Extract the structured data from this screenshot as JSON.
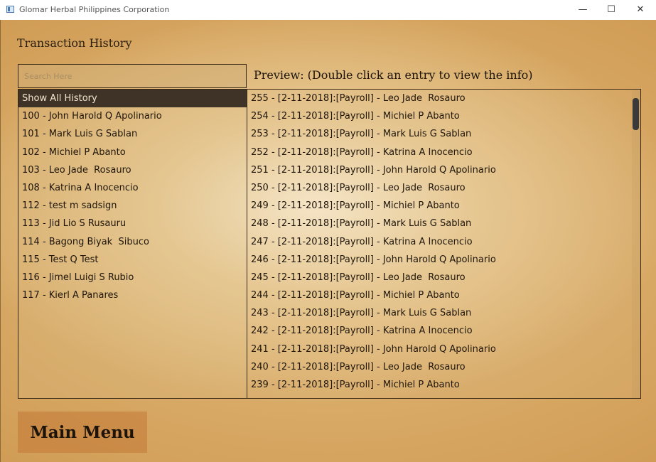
{
  "window": {
    "title": "Glomar Herbal Philippines Corporation",
    "minimize_glyph": "—",
    "maximize_glyph": "☐",
    "close_glyph": "✕"
  },
  "page": {
    "heading": "Transaction History",
    "preview_label": "Preview: (Double click an entry to view the info)",
    "main_menu_label": "Main Menu"
  },
  "search": {
    "placeholder": "Search Here",
    "value": ""
  },
  "employees": [
    "Show All History",
    "100 - John Harold Q Apolinario",
    "101 - Mark Luis G Sablan",
    "102 - Michiel P Abanto",
    "103 - Leo Jade  Rosauro",
    "108 - Katrina A Inocencio",
    "112 - test m sadsign",
    "113 - Jid Lio S Rusauru",
    "114 - Bagong Biyak  Sibuco",
    "115 - Test Q Test",
    "116 - Jimel Luigi S Rubio",
    "117 - Kierl A Panares"
  ],
  "selected_employee_index": 0,
  "transactions": [
    "255 - [2-11-2018]:[Payroll] - Leo Jade  Rosauro",
    "254 - [2-11-2018]:[Payroll] - Michiel P Abanto",
    "253 - [2-11-2018]:[Payroll] - Mark Luis G Sablan",
    "252 - [2-11-2018]:[Payroll] - Katrina A Inocencio",
    "251 - [2-11-2018]:[Payroll] - John Harold Q Apolinario",
    "250 - [2-11-2018]:[Payroll] - Leo Jade  Rosauro",
    "249 - [2-11-2018]:[Payroll] - Michiel P Abanto",
    "248 - [2-11-2018]:[Payroll] - Mark Luis G Sablan",
    "247 - [2-11-2018]:[Payroll] - Katrina A Inocencio",
    "246 - [2-11-2018]:[Payroll] - John Harold Q Apolinario",
    "245 - [2-11-2018]:[Payroll] - Leo Jade  Rosauro",
    "244 - [2-11-2018]:[Payroll] - Michiel P Abanto",
    "243 - [2-11-2018]:[Payroll] - Mark Luis G Sablan",
    "242 - [2-11-2018]:[Payroll] - Katrina A Inocencio",
    "241 - [2-11-2018]:[Payroll] - John Harold Q Apolinario",
    "240 - [2-11-2018]:[Payroll] - Leo Jade  Rosauro",
    "239 - [2-11-2018]:[Payroll] - Michiel P Abanto"
  ]
}
